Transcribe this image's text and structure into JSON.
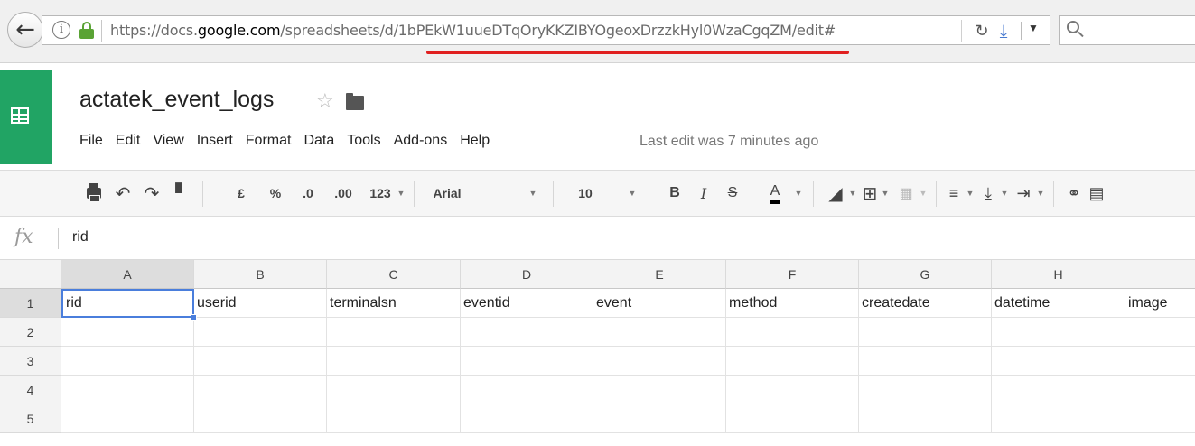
{
  "browser": {
    "back_icon": "back-arrow-icon",
    "url_prefix": "https://docs.",
    "url_domain": "google.com",
    "url_path": "/spreadsheets/d/1bPEkW1uueDTqOryKKZIBYOgeoxDrzzkHyl0WzaCgqZM/edit#",
    "reload_icon": "C",
    "search_icon": "search-icon",
    "accent_color": "#e02020"
  },
  "sheets": {
    "brand_color": "#21a464",
    "title": "actatek_event_logs",
    "star_glyph": "☆",
    "menu": [
      "File",
      "Edit",
      "View",
      "Insert",
      "Format",
      "Data",
      "Tools",
      "Add-ons",
      "Help"
    ],
    "last_edit": "Last edit was 7 minutes ago"
  },
  "toolbar": {
    "currency": "£",
    "percent": "%",
    "dec_decrease": ".0",
    "dec_increase": ".00",
    "format_more": "123",
    "font": "Arial",
    "size": "10",
    "bold": "B",
    "italic": "I",
    "strike": "S",
    "text_color": "A"
  },
  "formula_bar": {
    "fx_label": "fx",
    "value": "rid"
  },
  "grid": {
    "columns": [
      "A",
      "B",
      "C",
      "D",
      "E",
      "F",
      "G",
      "H"
    ],
    "rows": [
      "1",
      "2",
      "3",
      "4",
      "5"
    ],
    "cells": [
      [
        "rid",
        "userid",
        "terminalsn",
        "eventid",
        "event",
        "method",
        "createdate",
        "datetime",
        "image"
      ],
      [
        "",
        "",
        "",
        "",
        "",
        "",
        "",
        "",
        ""
      ],
      [
        "",
        "",
        "",
        "",
        "",
        "",
        "",
        "",
        ""
      ],
      [
        "",
        "",
        "",
        "",
        "",
        "",
        "",
        "",
        ""
      ]
    ],
    "active_cell": "A1",
    "selection_color": "#4a7edc"
  }
}
